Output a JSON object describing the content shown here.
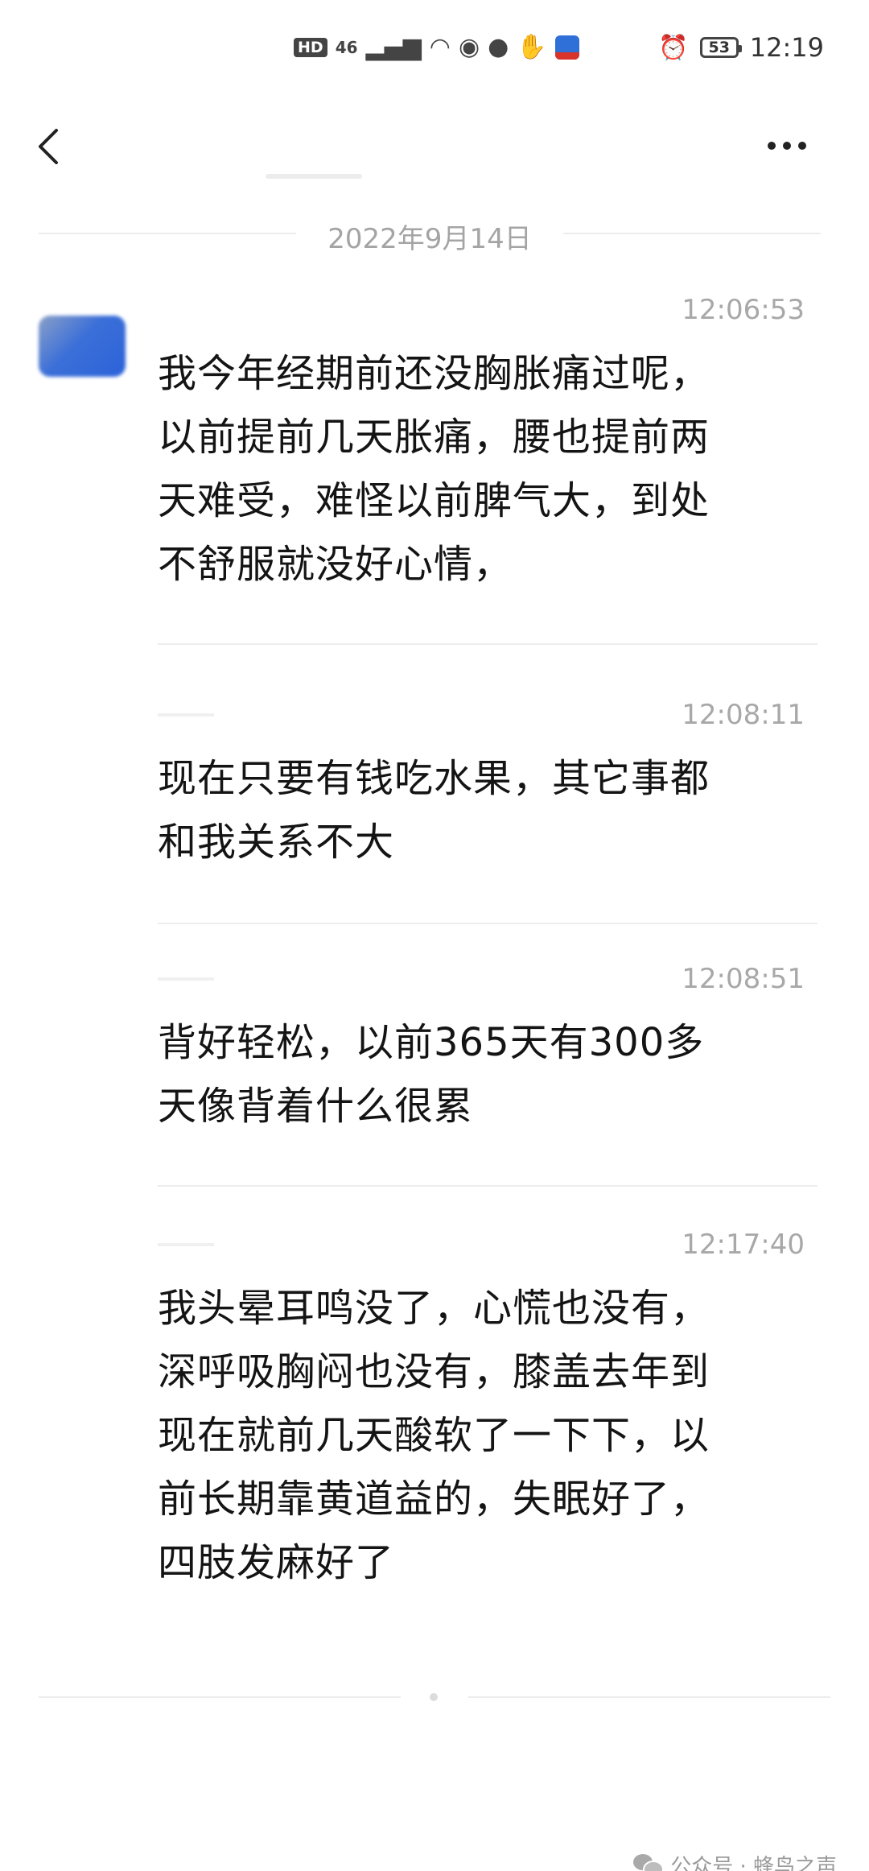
{
  "status_bar": {
    "hd": "HD",
    "signal": "46",
    "battery": "53",
    "time": "12:19"
  },
  "nav": {
    "title": ""
  },
  "date_divider": "2022年9月14日",
  "messages": [
    {
      "time": "12:06:53",
      "text": "我今年经期前还没胸胀痛过呢，\n以前提前几天胀痛，腰也提前两\n天难受，难怪以前脾气大，到处\n不舒服就没好心情，"
    },
    {
      "time": "12:08:11",
      "text": "现在只要有钱吃水果，其它事都\n和我关系不大"
    },
    {
      "time": "12:08:51",
      "text": "背好轻松，以前365天有300多\n天像背着什么很累"
    },
    {
      "time": "12:17:40",
      "text": "我头晕耳鸣没了，心慌也没有，\n深呼吸胸闷也没有，膝盖去年到\n现在就前几天酸软了一下下，以\n前长期靠黄道益的，失眠好了，\n四肢发麻好了"
    }
  ],
  "watermark": {
    "text": "公众号 · 蜂鸟之声"
  }
}
